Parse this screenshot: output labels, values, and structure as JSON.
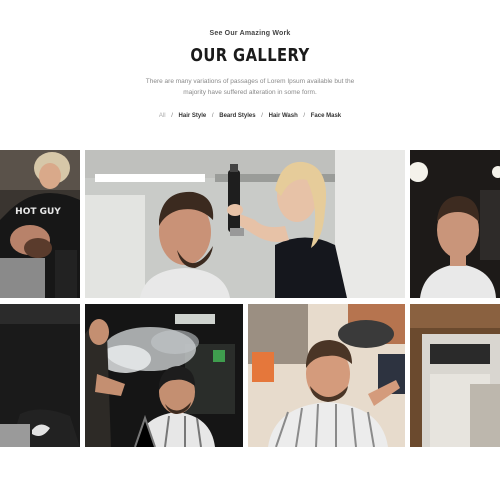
{
  "section": {
    "kicker": "See Our Amazing Work",
    "title": "OUR GALLERY",
    "description_line1": "There are many variations of passages of Lorem Ipsum available but the",
    "description_line2": "majority have suffered alteration in some form."
  },
  "filters": [
    {
      "label": "All",
      "active": true
    },
    {
      "label": "Hair Style",
      "active": false
    },
    {
      "label": "Beard Styles",
      "active": false
    },
    {
      "label": "Hair Wash",
      "active": false
    },
    {
      "label": "Face Mask",
      "active": false
    }
  ],
  "gallery": {
    "shirt_text": "HOT GUY"
  }
}
